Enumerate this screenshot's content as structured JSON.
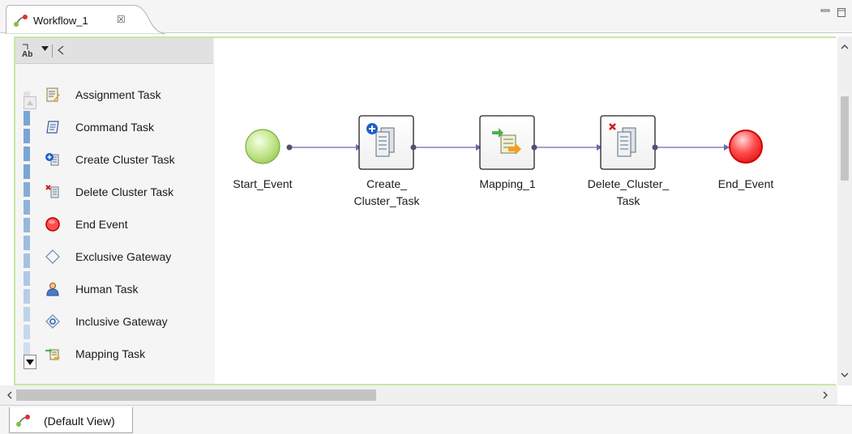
{
  "editor_tab": {
    "title": "Workflow_1",
    "close_glyph": "☒",
    "icon": "workflow-icon"
  },
  "window_controls": {
    "minimize_icon": "minimize-icon",
    "maximize_icon": "maximize-icon"
  },
  "palette": {
    "items": [
      {
        "label": "Assignment Task",
        "icon": "assignment-task-icon"
      },
      {
        "label": "Command Task",
        "icon": "command-task-icon"
      },
      {
        "label": "Create Cluster Task",
        "icon": "create-cluster-task-icon"
      },
      {
        "label": "Delete Cluster Task",
        "icon": "delete-cluster-task-icon"
      },
      {
        "label": "End Event",
        "icon": "end-event-icon"
      },
      {
        "label": "Exclusive Gateway",
        "icon": "exclusive-gateway-icon"
      },
      {
        "label": "Human Task",
        "icon": "human-task-icon"
      },
      {
        "label": "Inclusive Gateway",
        "icon": "inclusive-gateway-icon"
      },
      {
        "label": "Mapping Task",
        "icon": "mapping-task-icon"
      }
    ]
  },
  "workflow": {
    "nodes": [
      {
        "id": "start",
        "label": "Start_Event",
        "kind": "start-event"
      },
      {
        "id": "create",
        "label": "Create_\nCluster_Task",
        "kind": "create-cluster-task"
      },
      {
        "id": "mapping",
        "label": "Mapping_1",
        "kind": "mapping-task"
      },
      {
        "id": "delete",
        "label": "Delete_Cluster_\nTask",
        "kind": "delete-cluster-task"
      },
      {
        "id": "end",
        "label": "End_Event",
        "kind": "end-event"
      }
    ],
    "colors": {
      "start_fill": "#b6e07a",
      "end_fill": "#ff3b3b",
      "end_stroke": "#d00000",
      "connector": "#6a6ab0"
    }
  },
  "bottom": {
    "view_tab_label": "(Default View)"
  }
}
